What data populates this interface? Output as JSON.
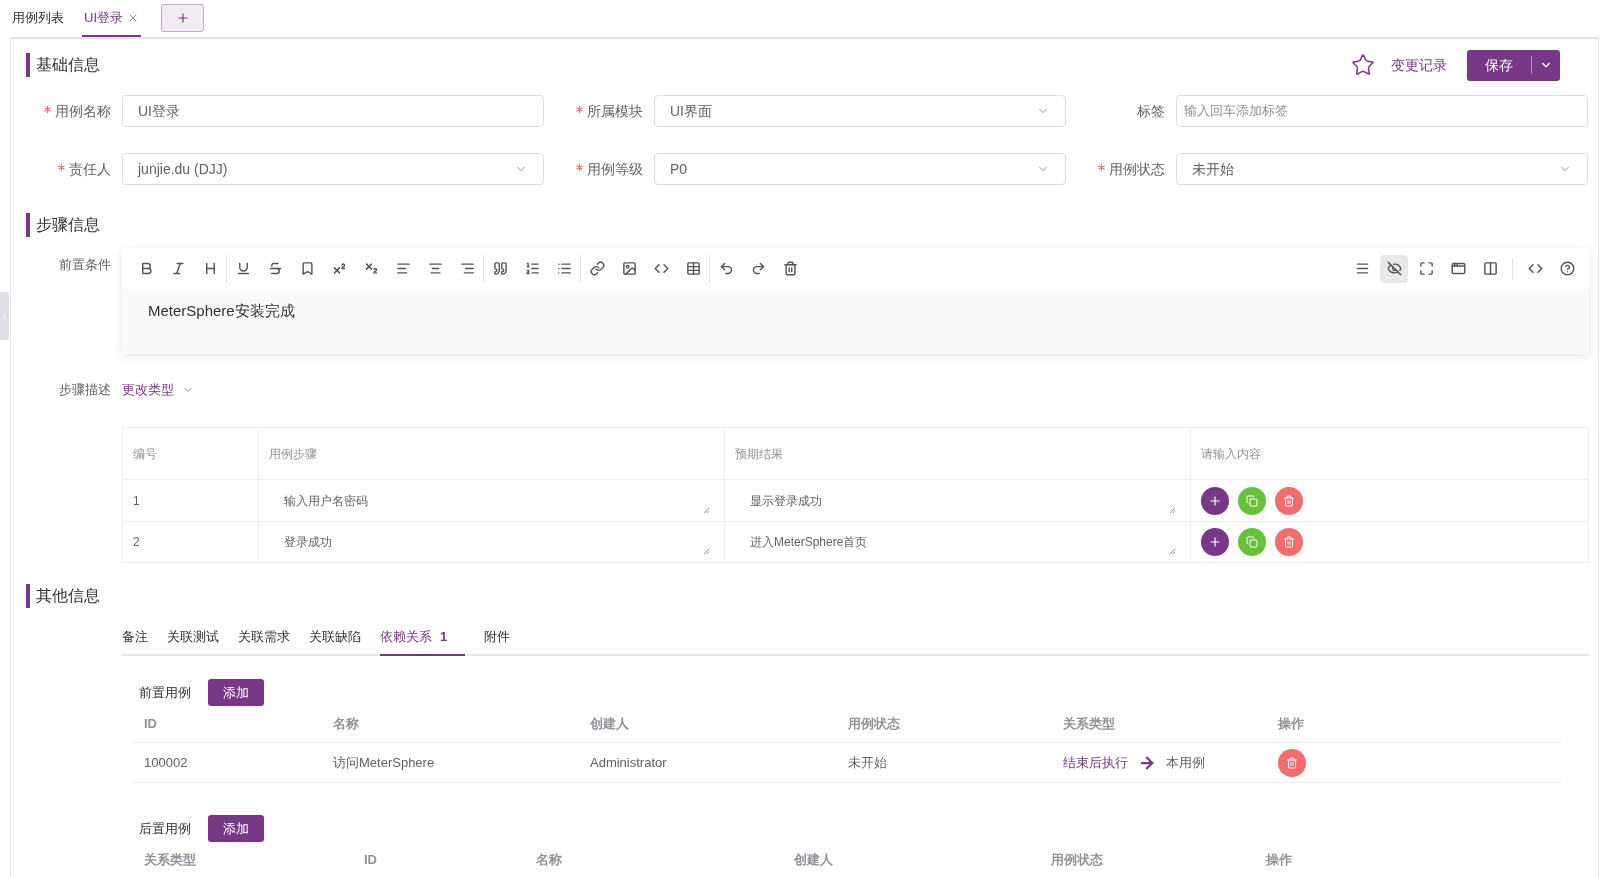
{
  "top_tabs": [
    {
      "label": "用例列表",
      "selected": false,
      "closable": false
    },
    {
      "label": "UI登录",
      "selected": true,
      "closable": true
    }
  ],
  "header_actions": {
    "history_link": "变更记录",
    "save_button": "保存"
  },
  "basic_info": {
    "title": "基础信息",
    "fields": [
      {
        "label": "用例名称",
        "required": true,
        "kind": "input",
        "value": "UI登录"
      },
      {
        "label": "所属模块",
        "required": true,
        "kind": "select",
        "value": "UI界面"
      },
      {
        "label": "标签",
        "required": false,
        "kind": "input",
        "placeholder": "输入回车添加标签"
      },
      {
        "label": "责任人",
        "required": true,
        "kind": "select",
        "value": "junjie.du (DJJ)"
      },
      {
        "label": "用例等级",
        "required": true,
        "kind": "select",
        "value": "P0"
      },
      {
        "label": "用例状态",
        "required": true,
        "kind": "select",
        "value": "未开始"
      }
    ]
  },
  "step_info": {
    "title": "步骤信息",
    "precondition_label": "前置条件",
    "precondition_text": "MeterSphere安装完成",
    "step_desc_label": "步骤描述",
    "change_type_link": "更改类型",
    "columns": [
      "编号",
      "用例步骤",
      "预期结果",
      "请输入内容"
    ],
    "rows": [
      {
        "num": "1",
        "step": "输入用户名密码",
        "expected": "显示登录成功"
      },
      {
        "num": "2",
        "step": "登录成功",
        "expected": "进入MeterSphere首页"
      }
    ]
  },
  "other_info": {
    "title": "其他信息",
    "tabs": [
      {
        "label": "备注",
        "selected": false
      },
      {
        "label": "关联测试",
        "selected": false
      },
      {
        "label": "关联需求",
        "selected": false
      },
      {
        "label": "关联缺陷",
        "selected": false
      },
      {
        "label": "依赖关系",
        "count": "1",
        "selected": true
      },
      {
        "label": "附件",
        "selected": false
      }
    ],
    "pre": {
      "label": "前置用例",
      "add_button": "添加",
      "columns": [
        "ID",
        "名称",
        "创建人",
        "用例状态",
        "关系类型",
        "操作"
      ],
      "rows": [
        {
          "id": "100002",
          "name": "访问MeterSphere",
          "creator": "Administrator",
          "status": "未开始",
          "relation_from": "结束后执行",
          "relation_to": "本用例"
        }
      ]
    },
    "post": {
      "label": "后置用例",
      "add_button": "添加",
      "columns": [
        "关系类型",
        "ID",
        "名称",
        "创建人",
        "用例状态",
        "操作"
      ]
    }
  }
}
